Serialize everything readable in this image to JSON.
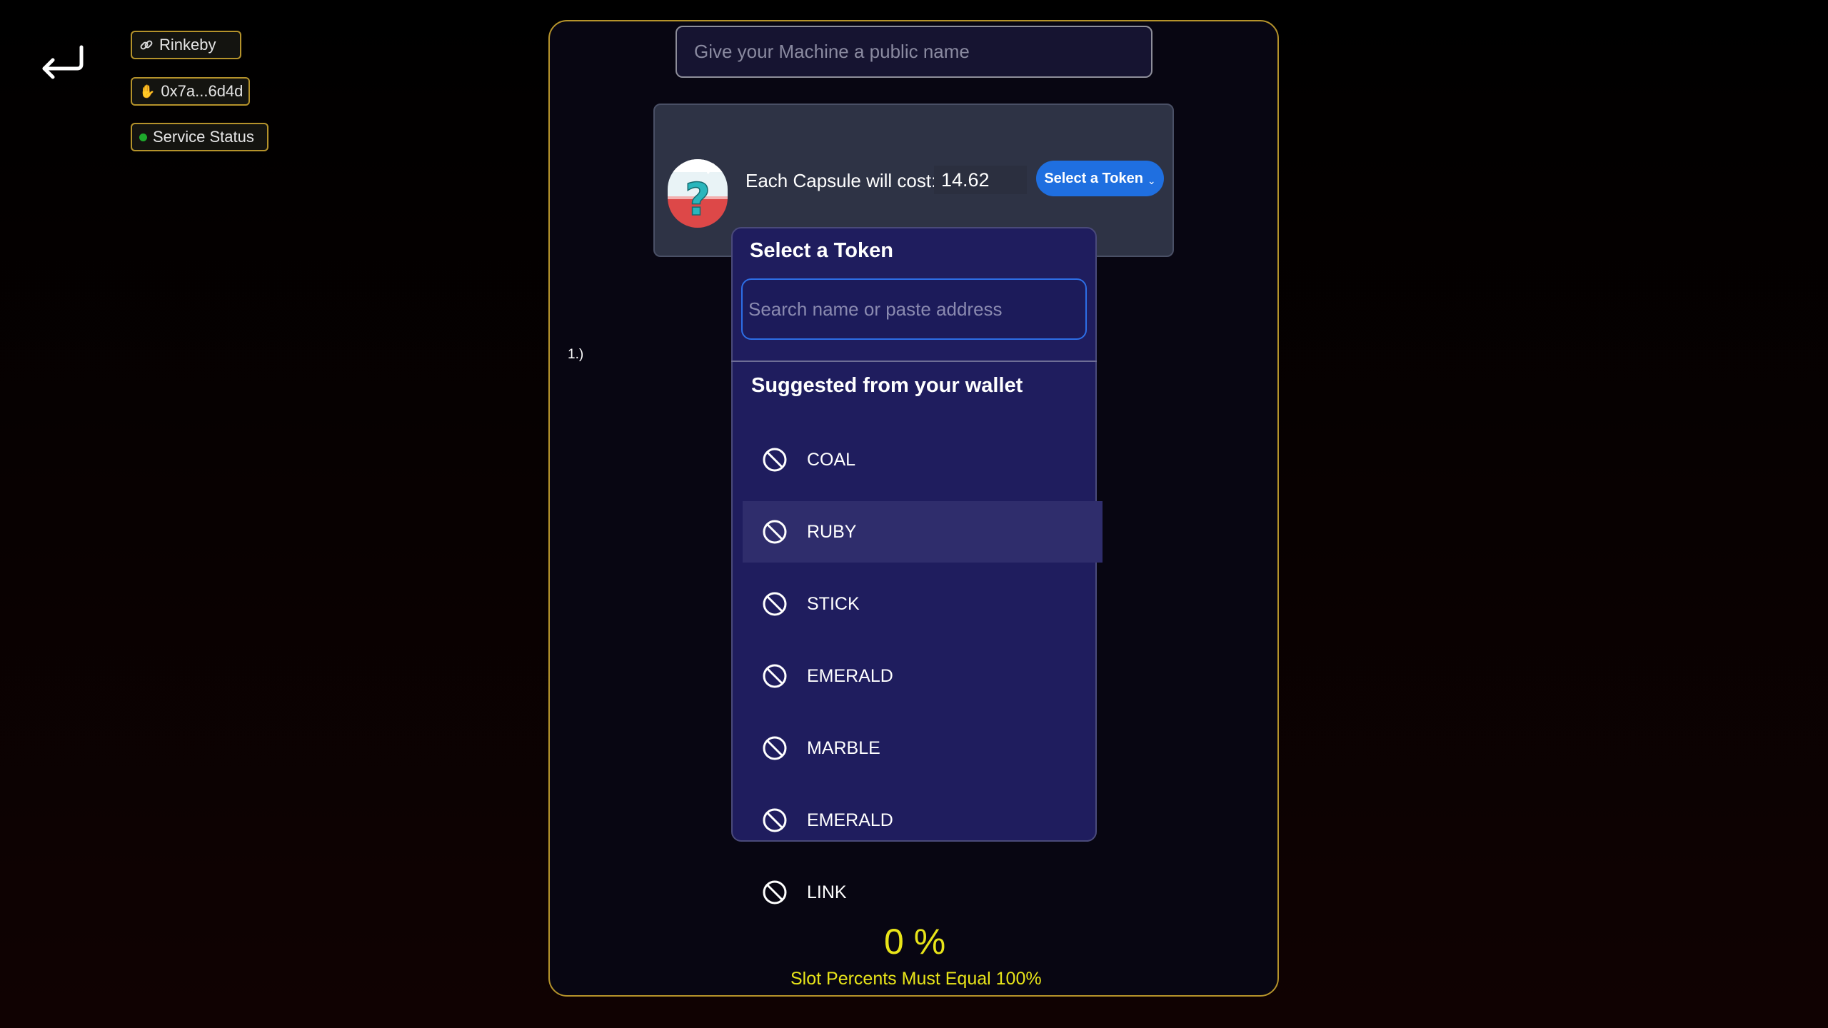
{
  "nav": {
    "back_icon": "return-arrow-icon"
  },
  "network": {
    "icon": "link-icon",
    "label": "Rinkeby"
  },
  "wallet": {
    "icon": "wave-hand-icon",
    "address": "0x7a...6d4d"
  },
  "service": {
    "dot_color": "#1eaa2c",
    "label": "Service Status"
  },
  "machine_name": {
    "placeholder": "Give your Machine a public name",
    "value": ""
  },
  "capsule": {
    "icon": "question-capsule-icon",
    "cost_label": "Each Capsule will cost:",
    "cost_value": "14.62",
    "token_button_label": "Select a Token"
  },
  "slot": {
    "label": "1.)"
  },
  "token_modal": {
    "title": "Select a Token",
    "search_placeholder": "Search name or paste address",
    "suggested_title": "Suggested from your wallet",
    "tokens": [
      {
        "name": "COAL",
        "icon": "ban-icon"
      },
      {
        "name": "RUBY",
        "icon": "ban-icon",
        "highlighted": true
      },
      {
        "name": "STICK",
        "icon": "ban-icon"
      },
      {
        "name": "EMERALD",
        "icon": "ban-icon"
      },
      {
        "name": "MARBLE",
        "icon": "ban-icon"
      },
      {
        "name": "EMERALD",
        "icon": "ban-icon"
      },
      {
        "name": "LINK",
        "icon": "ban-icon"
      }
    ]
  },
  "totals": {
    "percent": "0 %",
    "warning": "Slot Percents Must Equal 100%"
  },
  "colors": {
    "accent_border": "#b5932b",
    "warning_text": "#e8e419",
    "button_blue": "#1f6fe0",
    "modal_bg": "#1f1d5e"
  }
}
